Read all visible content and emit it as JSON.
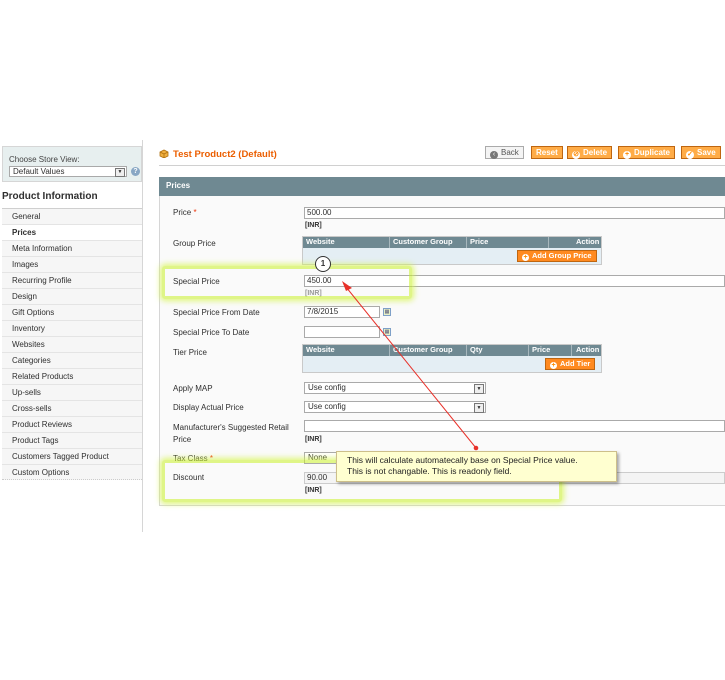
{
  "store_view": {
    "label": "Choose Store View:",
    "selected": "Default Values",
    "help_icon": "help-icon"
  },
  "sidebar": {
    "title": "Product Information",
    "tabs": [
      {
        "label": "General"
      },
      {
        "label": "Prices"
      },
      {
        "label": "Meta Information"
      },
      {
        "label": "Images"
      },
      {
        "label": "Recurring Profile"
      },
      {
        "label": "Design"
      },
      {
        "label": "Gift Options"
      },
      {
        "label": "Inventory"
      },
      {
        "label": "Websites"
      },
      {
        "label": "Categories"
      },
      {
        "label": "Related Products"
      },
      {
        "label": "Up-sells"
      },
      {
        "label": "Cross-sells"
      },
      {
        "label": "Product Reviews"
      },
      {
        "label": "Product Tags"
      },
      {
        "label": "Customers Tagged Product"
      },
      {
        "label": "Custom Options"
      }
    ],
    "active_tab": "Prices"
  },
  "header": {
    "title": "Test Product2 (Default)",
    "buttons": {
      "back": "Back",
      "reset": "Reset",
      "delete": "Delete",
      "duplicate": "Duplicate",
      "save": "Save"
    }
  },
  "panel": {
    "title": "Prices",
    "price": {
      "label": "Price",
      "required": "*",
      "value": "500.00",
      "currency": "[INR]"
    },
    "group_price": {
      "label": "Group Price",
      "columns": [
        "Website",
        "Customer Group",
        "Price",
        "Action"
      ],
      "add_button": "Add Group Price"
    },
    "special_price": {
      "label": "Special Price",
      "value": "450.00",
      "currency": "[INR]"
    },
    "special_from": {
      "label": "Special Price From Date",
      "value": "7/8/2015"
    },
    "special_to": {
      "label": "Special Price To Date",
      "value": ""
    },
    "tier_price": {
      "label": "Tier Price",
      "columns": [
        "Website",
        "Customer Group",
        "Qty",
        "Price",
        "Action"
      ],
      "add_button": "Add Tier"
    },
    "apply_map": {
      "label": "Apply MAP",
      "value": "Use config"
    },
    "display_actual_price": {
      "label": "Display Actual Price",
      "value": "Use config"
    },
    "msrp": {
      "label_line1": "Manufacturer's Suggested Retail",
      "label_line2": "Price",
      "value": "",
      "currency": "[INR]"
    },
    "tax_class": {
      "label": "Tax Class",
      "required": "*",
      "value": "None"
    },
    "discount": {
      "label": "Discount",
      "value": "90.00",
      "currency": "[INR]"
    }
  },
  "annotation": {
    "badge": "1",
    "tooltip_line1": "This will calculate automatecally base on Special Price value.",
    "tooltip_line2": "This is not changable. This is readonly field.",
    "highlight_color": "#c8f028",
    "arrow_color": "#e8312a"
  }
}
